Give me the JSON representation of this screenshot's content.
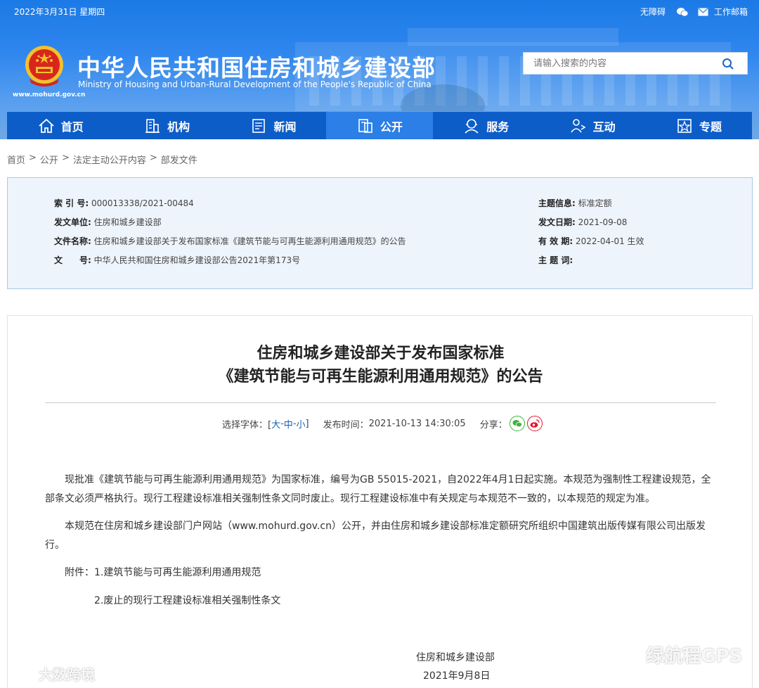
{
  "topbar": {
    "date": "2022年3月31日 星期四",
    "accessibility": "无障碍",
    "mail": "工作邮箱"
  },
  "site": {
    "title": "中华人民共和国住房和城乡建设部",
    "subtitle": "Ministry of Housing and Urban-Rural Development of the People's Republic of China",
    "url": "www.mohurd.gov.cn"
  },
  "search": {
    "placeholder": "请输入搜索的内容"
  },
  "nav": {
    "items": [
      {
        "label": "首页",
        "icon": "home-icon"
      },
      {
        "label": "机构",
        "icon": "building-icon"
      },
      {
        "label": "新闻",
        "icon": "news-icon"
      },
      {
        "label": "公开",
        "icon": "disclosure-icon",
        "active": true
      },
      {
        "label": "服务",
        "icon": "service-icon"
      },
      {
        "label": "互动",
        "icon": "interact-icon"
      },
      {
        "label": "专题",
        "icon": "topic-icon"
      }
    ]
  },
  "breadcrumb": {
    "items": [
      "首页",
      "公开",
      "法定主动公开内容",
      "部发文件"
    ],
    "sep": ">"
  },
  "info": {
    "index_key": "索 引 号:",
    "index_val": "000013338/2021-00484",
    "issuer_key": "发文单位:",
    "issuer_val": "住房和城乡建设部",
    "docname_key": "文件名称:",
    "docname_val": "住房和城乡建设部关于发布国家标准《建筑节能与可再生能源利用通用规范》的公告",
    "docno_key": "文　　号:",
    "docno_val": "中华人民共和国住房和城乡建设部公告2021年第173号",
    "topic_key": "主题信息:",
    "topic_val": "标准定额",
    "date_key": "发文日期:",
    "date_val": "2021-09-08",
    "valid_key": "有 效 期:",
    "valid_val": "2022-04-01 生效",
    "subject_key": "主 题 词:",
    "subject_val": ""
  },
  "article": {
    "title_line1": "住房和城乡建设部关于发布国家标准",
    "title_line2": "《建筑节能与可再生能源利用通用规范》的公告",
    "font_label": "选择字体：[",
    "font_large": "大",
    "font_medium": "中",
    "font_small": "小",
    "font_sep": "-",
    "font_close": "]",
    "publish_label": "发布时间：",
    "publish_time": "2021-10-13 14:30:05",
    "share_label": "分享：",
    "para1": "现批准《建筑节能与可再生能源利用通用规范》为国家标准，编号为GB 55015-2021，自2022年4月1日起实施。本规范为强制性工程建设规范，全部条文必须严格执行。现行工程建设标准相关强制性条文同时废止。现行工程建设标准中有关规定与本规范不一致的，以本规范的规定为准。",
    "para2": "本规范在住房和城乡建设部门户网站（www.mohurd.gov.cn）公开，并由住房和城乡建设部标准定额研究所组织中国建筑出版传媒有限公司出版发行。",
    "attach_label": "附件：",
    "attach1": "1.建筑节能与可再生能源利用通用规范",
    "attach2": "2.废止的现行工程建设标准相关强制性条文",
    "sign_org": "住房和城乡建设部",
    "sign_date": "2021年9月8日"
  },
  "watermarks": {
    "left": "大数跨境",
    "right": "绿航程GPS"
  },
  "colors": {
    "nav_bg": "#0d5dc9",
    "nav_active": "#2b7fe6",
    "wechat": "#3fb23f",
    "weibo": "#e6162d"
  }
}
